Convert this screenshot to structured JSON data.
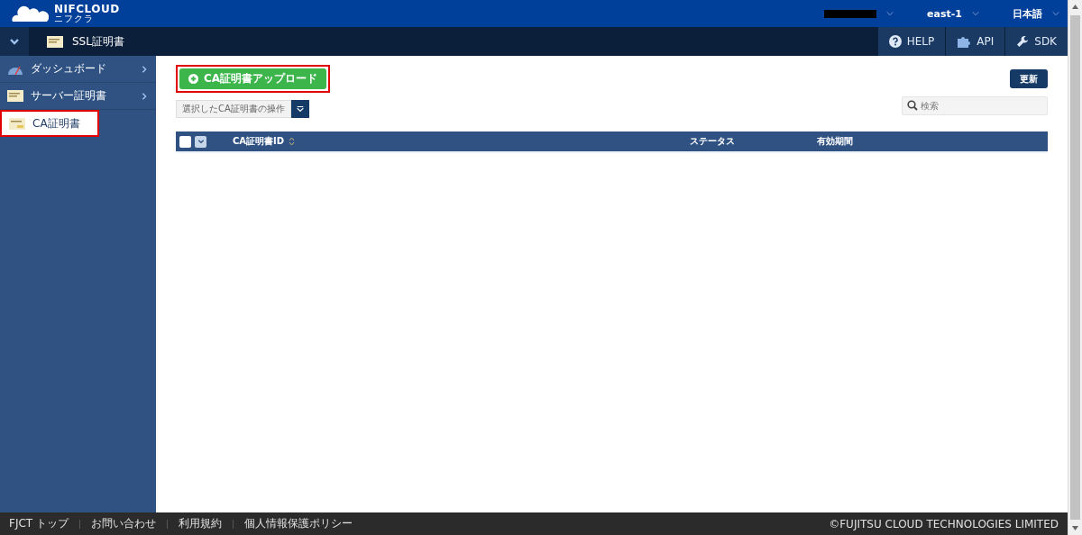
{
  "header": {
    "logo": "NIFCLOUD",
    "logo_sub": "ニフクラ",
    "region": "east-1",
    "language": "日本語"
  },
  "subbar": {
    "title": "SSL証明書",
    "tools": [
      {
        "label": "HELP",
        "kind": "help"
      },
      {
        "label": "API",
        "kind": "api"
      },
      {
        "label": "SDK",
        "kind": "sdk"
      }
    ]
  },
  "sidebar": {
    "items": [
      {
        "label": "ダッシュボード",
        "kind": "dashboard",
        "selected": false,
        "has_chevron": true,
        "highlighted": false
      },
      {
        "label": "サーバー証明書",
        "kind": "cert",
        "selected": false,
        "has_chevron": true,
        "highlighted": false
      },
      {
        "label": "CA証明書",
        "kind": "ca",
        "selected": true,
        "has_chevron": false,
        "highlighted": true
      }
    ]
  },
  "toolbar": {
    "upload_button": {
      "label": "CA証明書アップロード",
      "highlighted": true
    },
    "refresh_button": "更新",
    "action_select": "選択したCA証明書の操作",
    "search": {
      "placeholder": "検索"
    }
  },
  "table": {
    "select_all_checked": false,
    "columns": [
      {
        "label": "CA証明書ID",
        "sortable": true
      },
      {
        "label": "ステータス",
        "sortable": false
      },
      {
        "label": "有効期間",
        "sortable": false
      }
    ]
  },
  "footer": {
    "links": [
      "FJCT トップ",
      "お問い合わせ",
      "利用規約",
      "個人情報保護ポリシー"
    ],
    "copyright": "©FUJITSU CLOUD TECHNOLOGIES LIMITED"
  }
}
